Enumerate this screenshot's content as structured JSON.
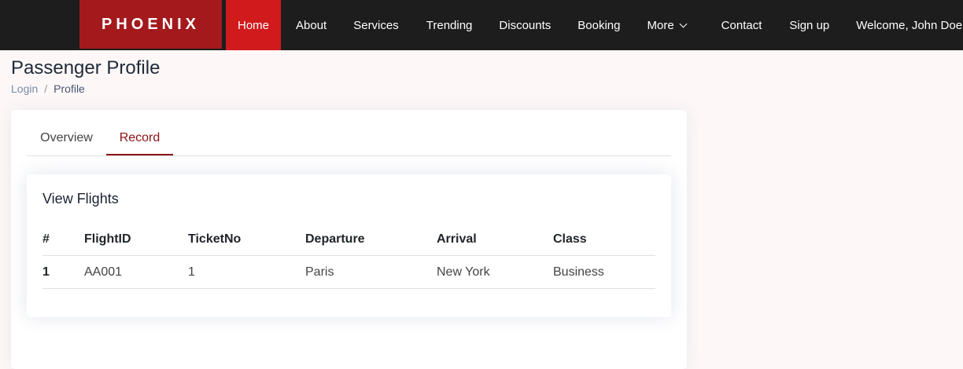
{
  "brand": "PHOENIX",
  "nav": {
    "items": [
      {
        "label": "Home"
      },
      {
        "label": "About"
      },
      {
        "label": "Services"
      },
      {
        "label": "Trending"
      },
      {
        "label": "Discounts"
      },
      {
        "label": "Booking"
      },
      {
        "label": "More"
      },
      {
        "label": "Contact"
      },
      {
        "label": "Sign up"
      },
      {
        "label": "Welcome, John Doe"
      }
    ],
    "active": "Home"
  },
  "page": {
    "title": "Passenger Profile",
    "breadcrumb": [
      "Login",
      "Profile"
    ],
    "breadcrumb_separator": "/"
  },
  "tabs": [
    {
      "label": "Overview"
    },
    {
      "label": "Record"
    }
  ],
  "active_tab": "Record",
  "flights": {
    "title": "View Flights",
    "columns": [
      "#",
      "FlightID",
      "TicketNo",
      "Departure",
      "Arrival",
      "Class"
    ],
    "rows": [
      [
        "1",
        "AA001",
        "1",
        "Paris",
        "New York",
        "Business"
      ]
    ]
  },
  "colors": {
    "navbar_bg": "#1d1d1d",
    "logo_bg": "#a3191c",
    "active_nav_bg": "#d11a1c",
    "active_tab": "#8b1215",
    "page_bg": "#fdf8f7"
  },
  "icons": {
    "more_dropdown": "chevron-down-icon"
  }
}
